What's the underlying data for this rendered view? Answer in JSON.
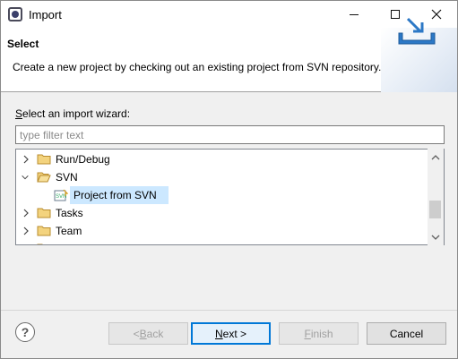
{
  "window": {
    "title": "Import",
    "icon": "eclipse-icon"
  },
  "banner": {
    "title": "Select",
    "description": "Create a new project by checking out an existing project from SVN repository.",
    "icon": "import-wizard-icon"
  },
  "wizard": {
    "label_prefix": "S",
    "label_rest": "elect an import wizard:",
    "filter_placeholder": "type filter text",
    "filter_value": ""
  },
  "tree": {
    "items": [
      {
        "label": "Run/Debug",
        "expanded": false,
        "icon": "folder-icon"
      },
      {
        "label": "SVN",
        "expanded": true,
        "icon": "folder-open-icon"
      },
      {
        "label": "Project from SVN",
        "child": true,
        "selected": true,
        "icon": "svn-project-icon"
      },
      {
        "label": "Tasks",
        "expanded": false,
        "icon": "folder-icon"
      },
      {
        "label": "Team",
        "expanded": false,
        "icon": "folder-icon"
      }
    ],
    "scroll_position": 0.72
  },
  "buttons": {
    "back_mnemonic": "B",
    "back_pre": "< ",
    "back_post": "ack",
    "next_mnemonic": "N",
    "next_post": "ext >",
    "finish_mnemonic": "F",
    "finish_post": "inish",
    "cancel": "Cancel"
  },
  "colors": {
    "selection": "#cce8ff",
    "folder": "#dcb67a",
    "default_button_border": "#0078d7"
  }
}
